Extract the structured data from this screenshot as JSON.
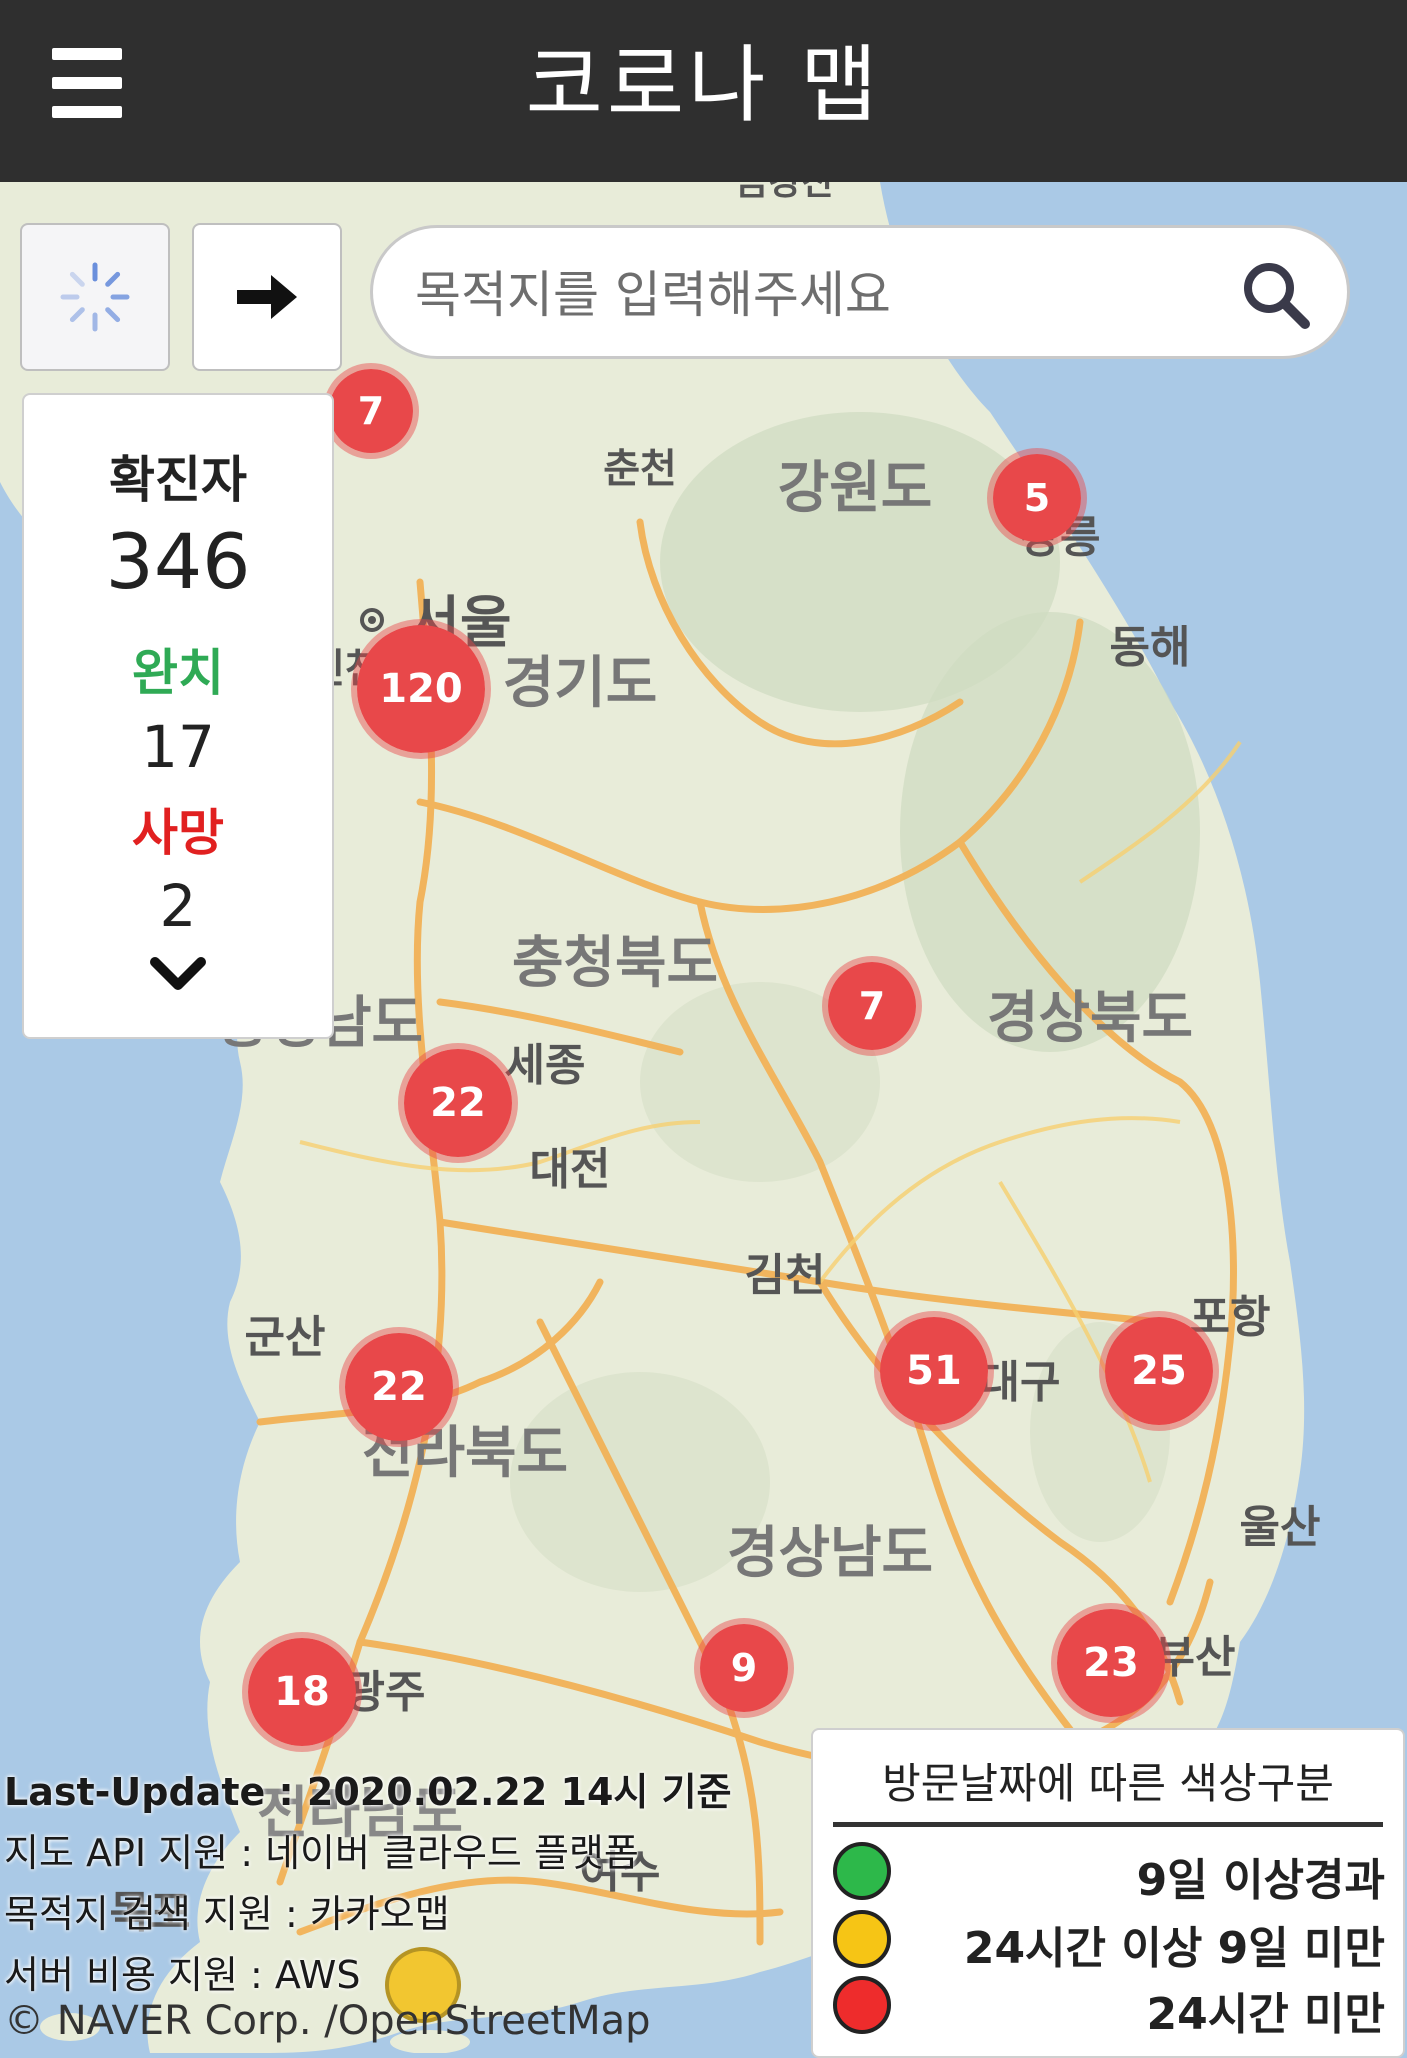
{
  "header": {
    "title": "코로나 맵",
    "menu_icon": "hamburger-menu-icon"
  },
  "controls": {
    "loading_icon": "loading-spinner-icon",
    "arrow_icon": "arrow-right-icon"
  },
  "search": {
    "placeholder": "목적지를 입력해주세요",
    "value": "",
    "icon": "search-icon"
  },
  "stats": {
    "confirmed_label": "확진자",
    "confirmed_value": "346",
    "recovered_label": "완치",
    "recovered_value": "17",
    "deaths_label": "사망",
    "deaths_value": "2",
    "expand_icon": "chevron-down-icon"
  },
  "map": {
    "places": [
      "춘천",
      "강원도",
      "강릉",
      "동해",
      "서울",
      "경기도",
      "충청북도",
      "충청남도",
      "세종",
      "대전",
      "경상북도",
      "김천",
      "군산",
      "포항",
      "대구",
      "전라북도",
      "울산",
      "경상남도",
      "부산",
      "광주",
      "목포",
      "여수",
      "전라남도",
      "금강산",
      "인천"
    ],
    "clusters": [
      "7",
      "5",
      "120",
      "7",
      "22",
      "22",
      "51",
      "25",
      "18",
      "9",
      "23"
    ]
  },
  "credits": {
    "last_update": "Last-Update : 2020.02.22 14시 기준",
    "map_api": "지도 API 지원 : 네이버 클라우드 플랫폼",
    "search_api": "목적지 검색 지원 : 카카오맵",
    "server": "서버 비용 지원 : AWS",
    "copyright": "© NAVER Corp. /OpenStreetMap"
  },
  "legend": {
    "title": "방문날짜에 따른 색상구분",
    "items": [
      {
        "label": "9일 이상경과",
        "color": "#2db84a"
      },
      {
        "label": "24시간 이상 9일 미만",
        "color": "#f6c515"
      },
      {
        "label": "24시간 미만",
        "color": "#ee2c2c"
      }
    ]
  },
  "colors": {
    "topbar": "#2f2f2f",
    "cluster": "#e8484a",
    "recovered": "#2faa55",
    "deaths": "#e12020"
  }
}
